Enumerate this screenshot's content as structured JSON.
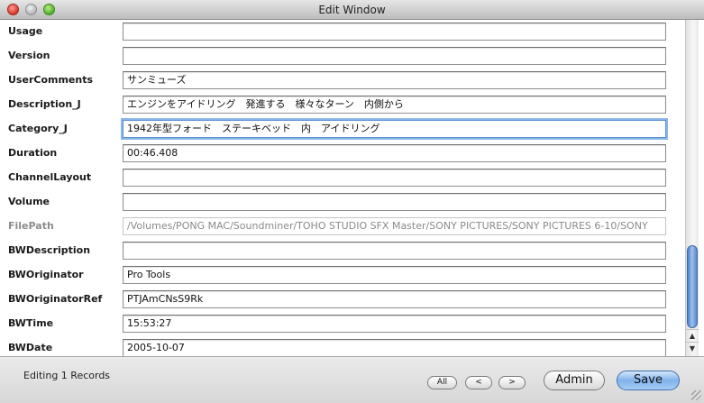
{
  "window": {
    "title": "Edit Window"
  },
  "fields": [
    {
      "label": "Usage",
      "value": ""
    },
    {
      "label": "Version",
      "value": ""
    },
    {
      "label": "UserComments",
      "value": "サンミューズ"
    },
    {
      "label": "Description_J",
      "value": "エンジンをアイドリング　発進する　様々なターン　内側から"
    },
    {
      "label": "Category_J",
      "value": "1942年型フォード　ステーキベッド　内　アイドリング"
    },
    {
      "label": "Duration",
      "value": "00:46.408"
    },
    {
      "label": "ChannelLayout",
      "value": ""
    },
    {
      "label": "Volume",
      "value": ""
    },
    {
      "label": "FilePath",
      "value": "/Volumes/PONG MAC/Soundminer/TOHO STUDIO SFX Master/SONY PICTURES/SONY PICTURES 6-10/SONY"
    },
    {
      "label": "BWDescription",
      "value": ""
    },
    {
      "label": "BWOriginator",
      "value": "Pro Tools"
    },
    {
      "label": "BWOriginatorRef",
      "value": "PTJAmCNsS9Rk"
    },
    {
      "label": "BWTime",
      "value": "15:53:27"
    },
    {
      "label": "BWDate",
      "value": "2005-10-07"
    }
  ],
  "footer": {
    "status": "Editing 1 Records",
    "all_label": "All",
    "prev_label": "<",
    "next_label": ">",
    "admin_label": "Admin",
    "save_label": "Save"
  },
  "scrollbar": {
    "up_glyph": "▲",
    "down_glyph": "▼"
  }
}
